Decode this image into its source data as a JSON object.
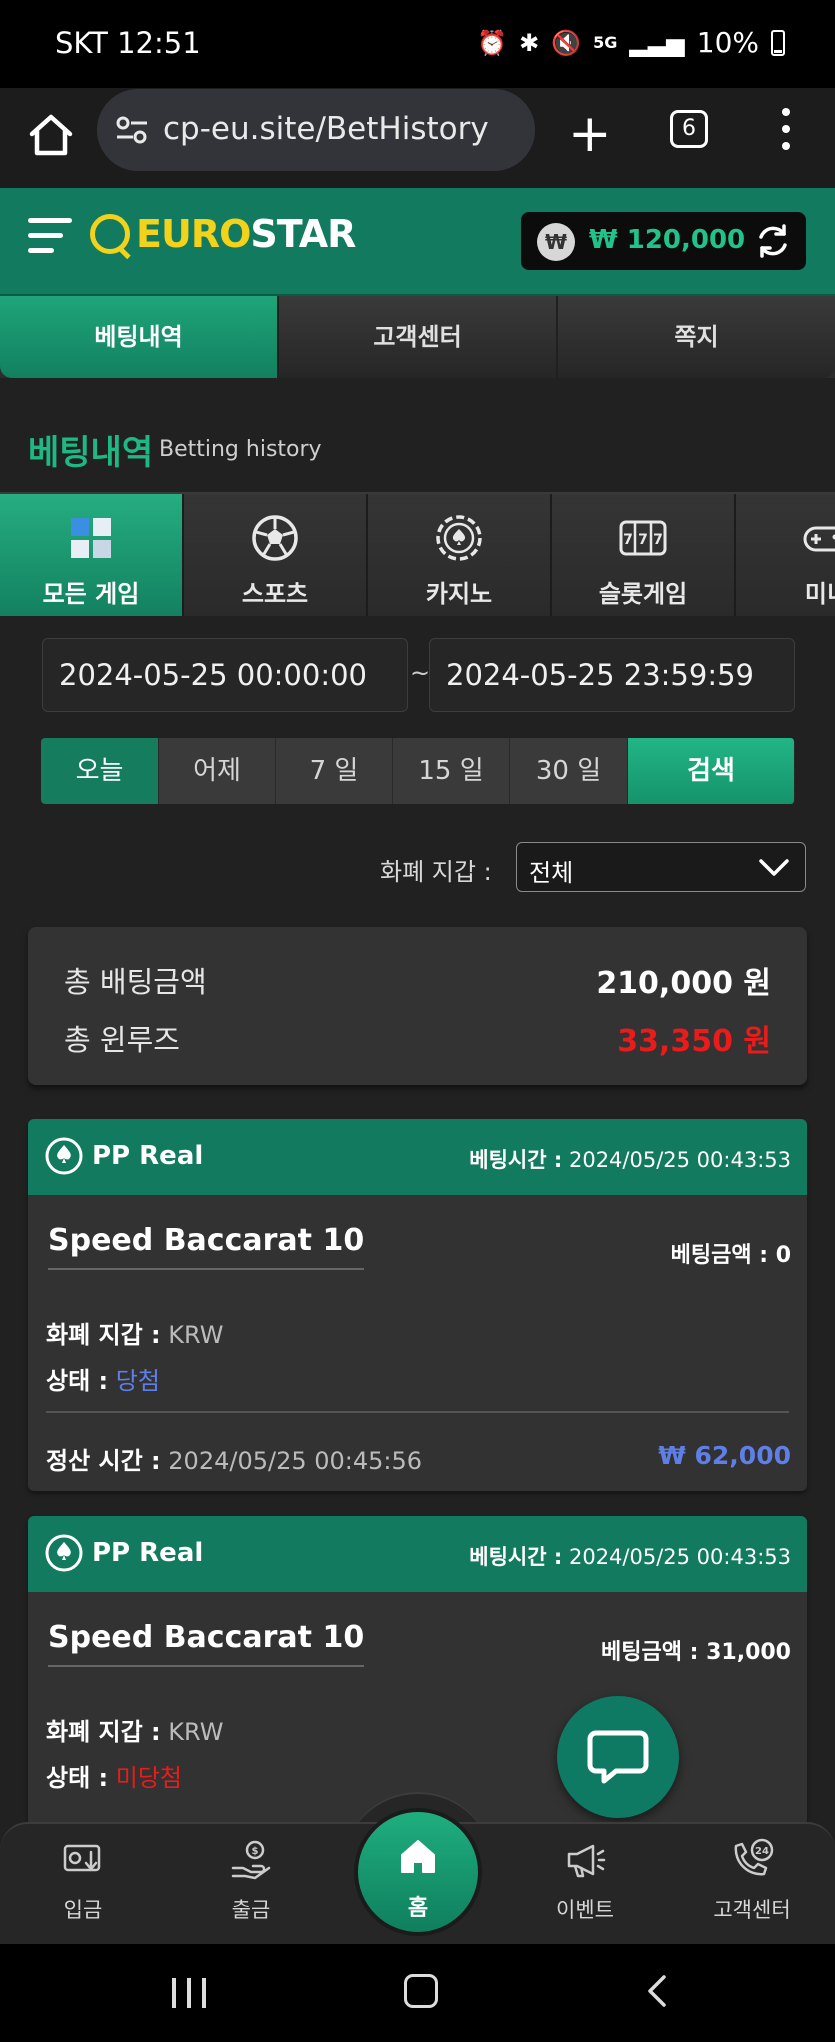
{
  "status_bar": {
    "carrier_time": "SKT 12:51",
    "battery": "10%",
    "network": "5G"
  },
  "browser": {
    "url": "cp-eu.site/BetHistory",
    "tab_count": "6"
  },
  "header": {
    "logo_part1": "EURO",
    "logo_part2": "STAR",
    "currency_symbol": "₩",
    "balance": "₩ 120,000"
  },
  "top_tabs": [
    {
      "label": "베팅내역",
      "active": true
    },
    {
      "label": "고객센터",
      "active": false
    },
    {
      "label": "쪽지",
      "active": false
    }
  ],
  "page": {
    "title": "베팅내역",
    "subtitle": "Betting history"
  },
  "game_tabs": [
    {
      "label": "모든 게임",
      "icon": "cube-icon",
      "active": true
    },
    {
      "label": "스포츠",
      "icon": "soccer-ball-icon",
      "active": false
    },
    {
      "label": "카지노",
      "icon": "casino-chip-icon",
      "active": false
    },
    {
      "label": "슬롯게임",
      "icon": "slot-machine-icon",
      "active": false
    },
    {
      "label": "미니",
      "icon": "gamepad-icon",
      "active": false
    }
  ],
  "filters": {
    "date_from": "2024-05-25 00:00:00",
    "separator": "~",
    "date_to": "2024-05-25 23:59:59",
    "periods": [
      "오늘",
      "어제",
      "7 일",
      "15 일",
      "30 일"
    ],
    "search_label": "검색",
    "currency_label": "화폐 지갑 :",
    "currency_value": "전체"
  },
  "summary": {
    "total_bet_label": "총 배팅금액",
    "total_bet_value": "210,000 원",
    "total_winloss_label": "총 윈루즈",
    "total_winloss_value": "33,350 원"
  },
  "bets": [
    {
      "provider": "PP Real",
      "bet_time_label": "베팅시간 :",
      "bet_time": "2024/05/25 00:43:53",
      "game": "Speed Baccarat 10",
      "bet_amount_label": "베팅금액 :",
      "bet_amount": "0",
      "currency_label": "화폐 지갑 :",
      "currency": "KRW",
      "status_label": "상태 :",
      "status": "당첨",
      "settle_label": "정산 시간 :",
      "settle_time": "2024/05/25 00:45:56",
      "payout": "₩ 62,000"
    },
    {
      "provider": "PP Real",
      "bet_time_label": "베팅시간 :",
      "bet_time": "2024/05/25 00:43:53",
      "game": "Speed Baccarat 10",
      "bet_amount_label": "베팅금액 :",
      "bet_amount": "31,000",
      "currency_label": "화폐 지갑 :",
      "currency": "KRW",
      "status_label": "상태 :",
      "status": "미당첨"
    }
  ],
  "bottom_nav": {
    "deposit": "입금",
    "withdraw": "출금",
    "home": "홈",
    "event": "이벤트",
    "support": "고객센터",
    "support_badge": "24"
  },
  "colors": {
    "brand_green": "#127a5e",
    "accent_green": "#1fb885",
    "logo_yellow": "#f2d21b",
    "win_blue": "#5f7fe6",
    "lose_red": "#ea1b1b"
  }
}
